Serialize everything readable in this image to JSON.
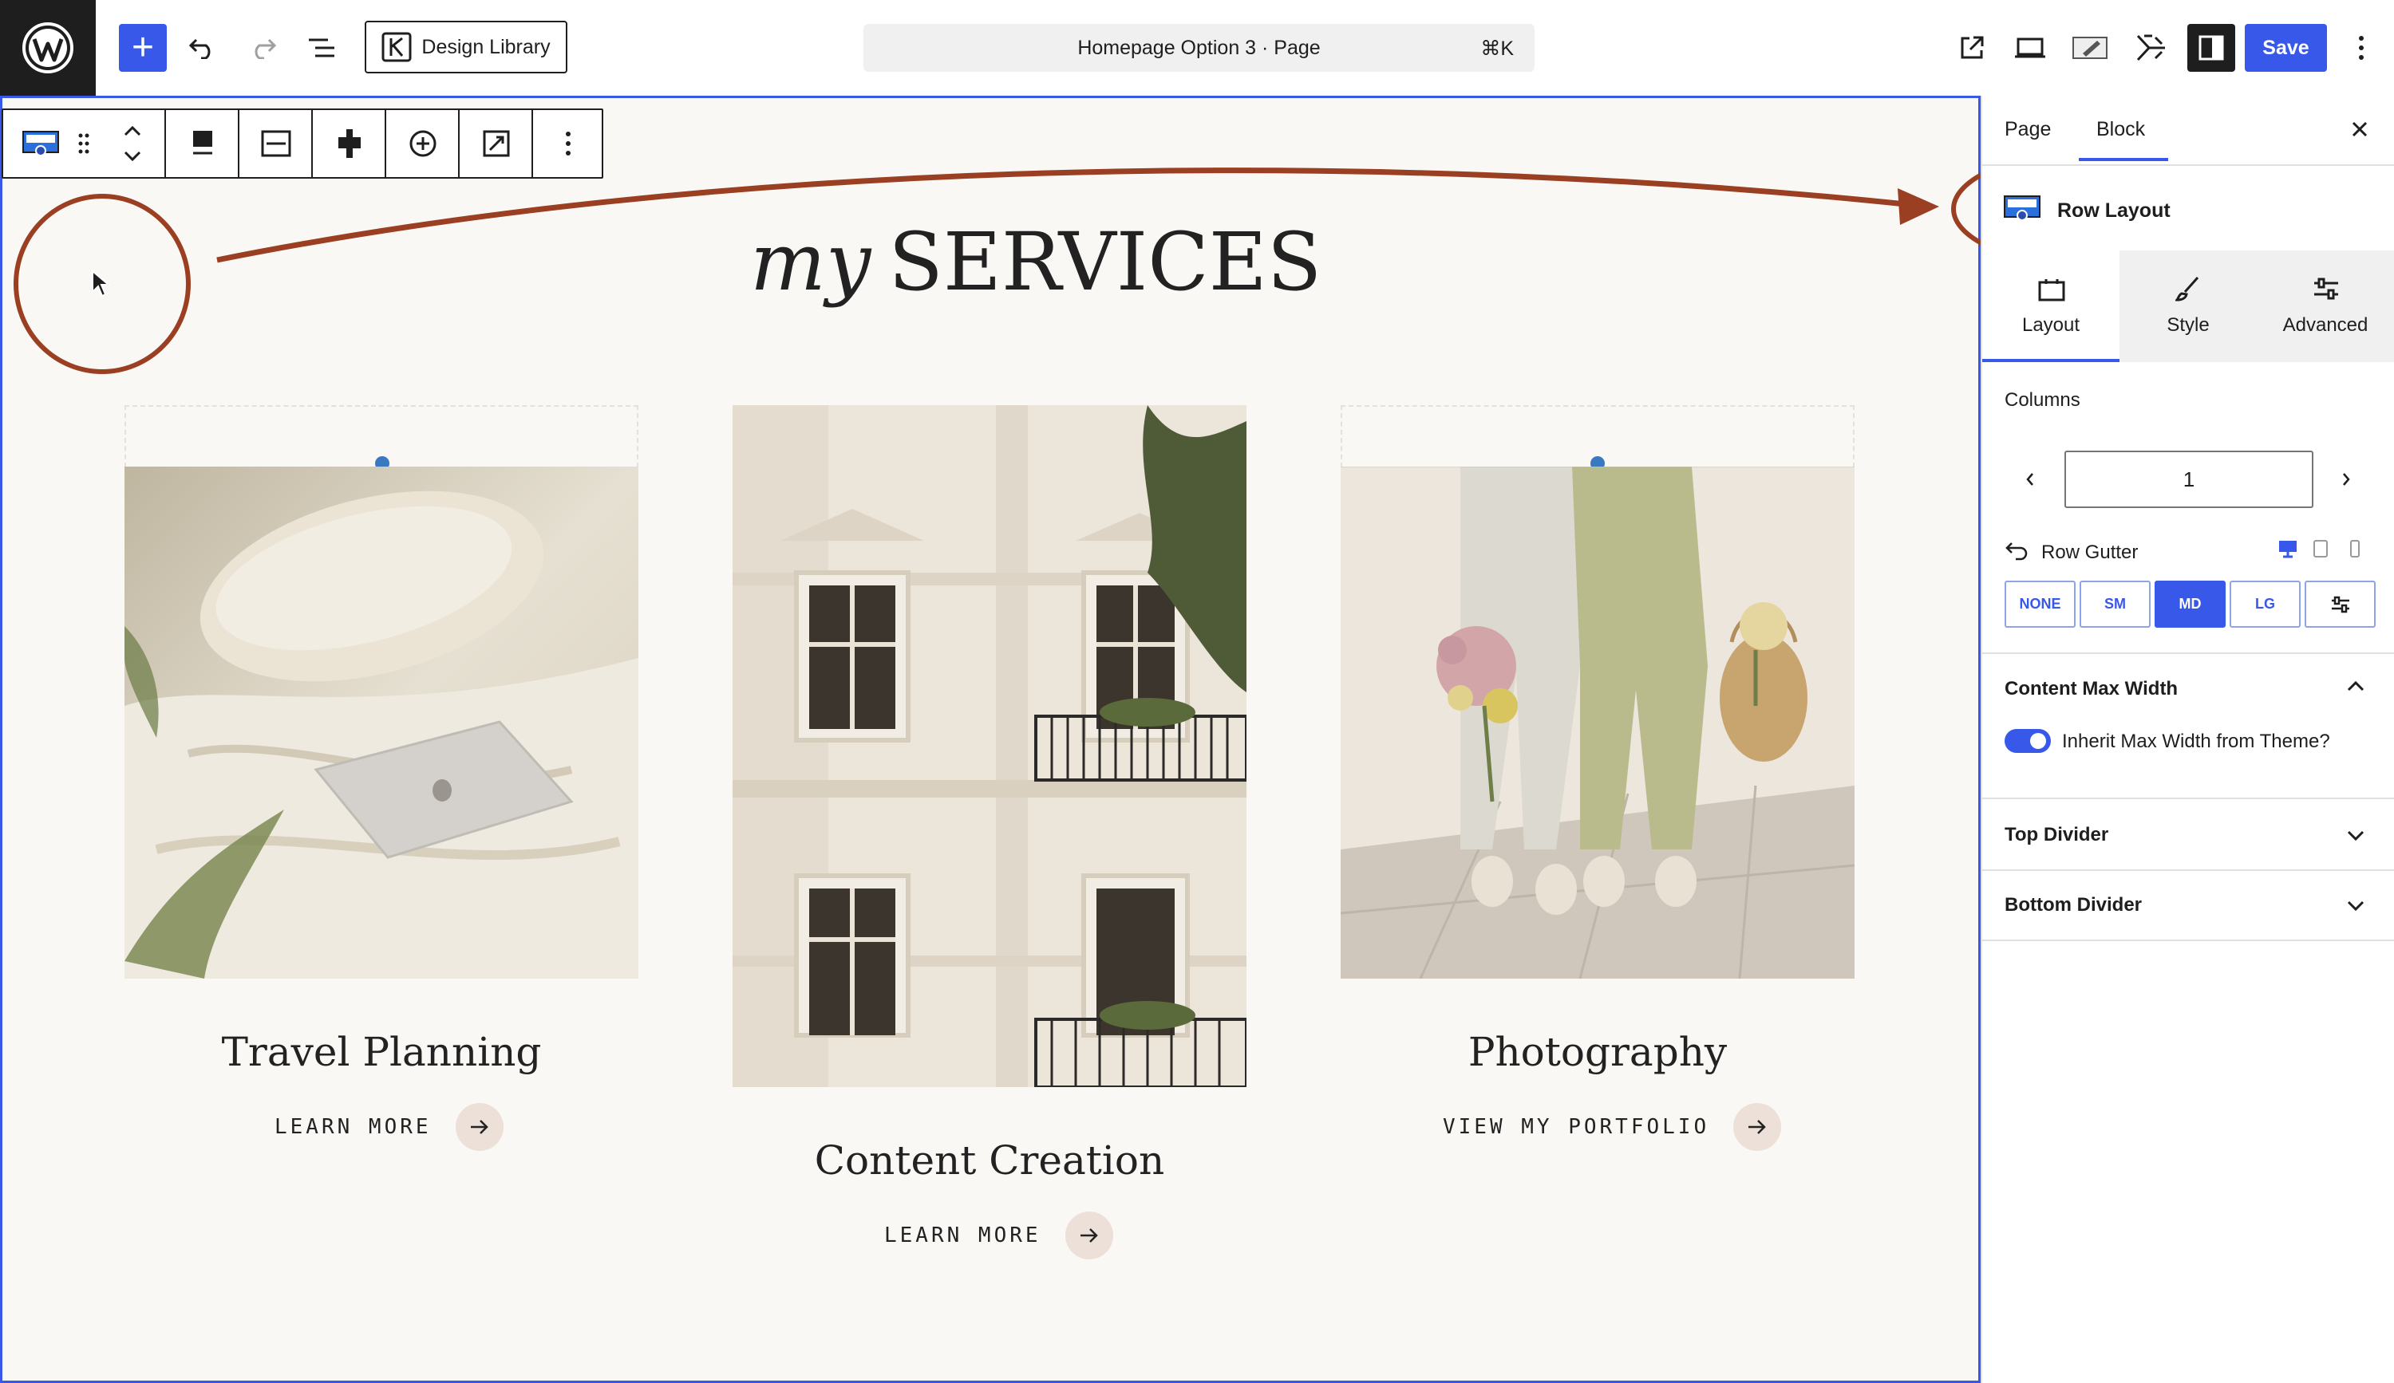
{
  "topbar": {
    "design_library_label": "Design Library",
    "document_title": "Homepage Option 3 · Page",
    "shortcut": "⌘K",
    "save_label": "Save"
  },
  "content": {
    "heading_italic": "my",
    "heading_caps": "SERVICES",
    "services": [
      {
        "title": "Travel Planning",
        "link": "LEARN MORE"
      },
      {
        "title": "Content Creation",
        "link": "LEARN MORE"
      },
      {
        "title": "Photography",
        "link": "VIEW MY PORTFOLIO"
      }
    ]
  },
  "sidebar": {
    "tabs": [
      "Page",
      "Block"
    ],
    "active_tab": "Block",
    "block_name": "Row Layout",
    "panel_tabs": [
      "Layout",
      "Style",
      "Advanced"
    ],
    "active_panel_tab": "Layout",
    "columns_label": "Columns",
    "columns_value": "1",
    "row_gutter_label": "Row Gutter",
    "gutter_options": [
      "NONE",
      "SM",
      "MD",
      "LG"
    ],
    "gutter_selected": "MD",
    "content_max_width_label": "Content Max Width",
    "inherit_label": "Inherit Max Width from Theme?",
    "inherit_enabled": true,
    "top_divider_label": "Top Divider",
    "bottom_divider_label": "Bottom Divider"
  },
  "colors": {
    "accent": "#3858e9",
    "annotation": "#9a3f22",
    "canvas_bg": "#faf8f5",
    "arrow_circle": "#ece0d8"
  }
}
